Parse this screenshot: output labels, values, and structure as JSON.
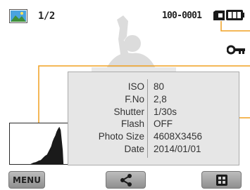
{
  "status_bar": {
    "image_counter": "1/2",
    "file_number": "100-0001",
    "icons": [
      "image-thumbnail-icon",
      "memory-card-icon",
      "battery-icon"
    ]
  },
  "protect_icon": "key-icon",
  "info_panel": {
    "rows": [
      {
        "label": "ISO",
        "value": "80"
      },
      {
        "label": "F.No",
        "value": "2,8"
      },
      {
        "label": "Shutter",
        "value": "1/30s"
      },
      {
        "label": "Flash",
        "value": "OFF"
      },
      {
        "label": "Photo Size",
        "value": "4608X3456"
      },
      {
        "label": "Date",
        "value": "2014/01/01"
      }
    ]
  },
  "bottom_bar": {
    "menu_label": "MENU",
    "share_icon": "share-icon",
    "thumbnail_icon": "thumbnail-view-icon"
  },
  "colors": {
    "callout": "#f0a020",
    "panel_bg": "#e6e6e6",
    "button": "#a8a8a8"
  }
}
